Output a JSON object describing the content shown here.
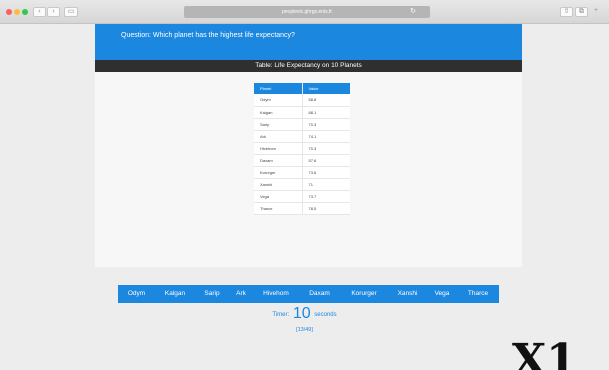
{
  "browser": {
    "url": "peoplevic.ghrgs.enis.fr",
    "colors": {
      "traffic_close": "#fc605c",
      "traffic_min": "#fdbc40",
      "traffic_max": "#34c84a"
    },
    "icons": [
      "back-icon",
      "forward-icon",
      "sidebar-icon",
      "reload-icon",
      "share-icon",
      "tabs-icon",
      "new-tab-icon"
    ]
  },
  "question": {
    "text": "Question: Which planet has the highest life expectancy?"
  },
  "table": {
    "title": "Table: Life Expectancy on 10 Planets",
    "headers": [
      "Planet",
      "Value"
    ],
    "rows": [
      [
        "Odym",
        "58.8"
      ],
      [
        "Kalgan",
        "88.1"
      ],
      [
        "Sarip",
        "70.3"
      ],
      [
        "Ark",
        "74.1"
      ],
      [
        "Hivehom",
        "70.3"
      ],
      [
        "Daxam",
        "57.8"
      ],
      [
        "Korurger",
        "73.6"
      ],
      [
        "Xanshi",
        "71"
      ],
      [
        "Vega",
        "73.7"
      ],
      [
        "Tharce",
        "78.5"
      ]
    ]
  },
  "answers": [
    "Odym",
    "Kalgan",
    "Sarip",
    "Ark",
    "Hivehom",
    "Daxam",
    "Korurger",
    "Xanshi",
    "Vega",
    "Tharce"
  ],
  "timer": {
    "label": "Timer:",
    "value": "10",
    "unit": "seconds"
  },
  "progress": "[13/49]",
  "watermark": "X1",
  "accent_color": "#1c87df"
}
